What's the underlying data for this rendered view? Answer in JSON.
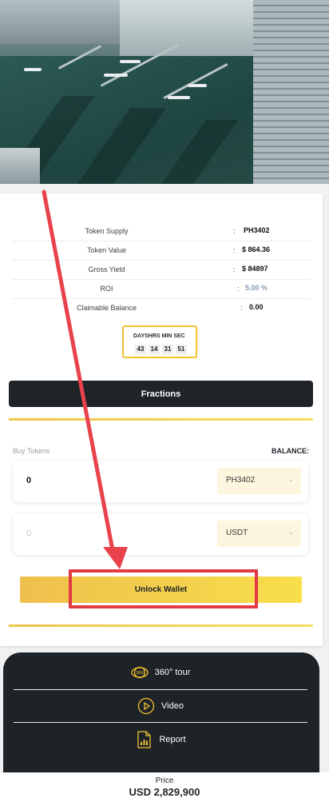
{
  "info": {
    "rows": [
      {
        "label": "Token Supply",
        "value": "PH3402"
      },
      {
        "label": "Token Value",
        "value": "$ 864.36"
      },
      {
        "label": "Gross Yield",
        "value": "$ 84897"
      },
      {
        "label": "ROI",
        "value": "5.00 %"
      },
      {
        "label": "Claimable Balance",
        "value": "0.00"
      }
    ],
    "separator": ":"
  },
  "timer": {
    "headings": "DAYSHRS MIN SEC",
    "days": "43",
    "hours": "14",
    "minutes": "31",
    "seconds": "51"
  },
  "fractions_button": "Fractions",
  "buy": {
    "label": "Buy Tokens",
    "balance_label": "BALANCE:",
    "token_amount": "0",
    "token_select": "PH3402",
    "usdt_amount": "0",
    "usdt_select": "USDT"
  },
  "unlock_button": "Unlock Wallet",
  "menu": {
    "tour": "360° tour",
    "video": "Video",
    "report": "Report"
  },
  "price": {
    "label": "Price",
    "value": "USD 2,829,900"
  },
  "colors": {
    "accent_gold": "#f2c230",
    "dark": "#1f2429",
    "annotation_red": "#e23b45"
  }
}
